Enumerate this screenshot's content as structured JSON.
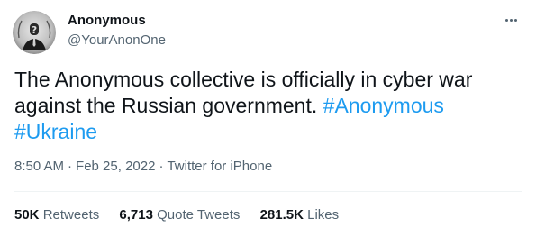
{
  "author": {
    "name": "Anonymous",
    "handle": "@YourAnonOne"
  },
  "tweet": {
    "text_line1": "The Anonymous collective is officially in cyber war",
    "text_line2_plain": "against the Russian government. ",
    "hashtags": [
      "#Anonymous",
      "#Ukraine"
    ]
  },
  "meta": {
    "time": "8:50 AM",
    "separator": "·",
    "date": "Feb 25, 2022",
    "source": "Twitter for iPhone"
  },
  "stats": {
    "retweets_count": "50K",
    "retweets_label": "Retweets",
    "quotes_count": "6,713",
    "quotes_label": "Quote Tweets",
    "likes_count": "281.5K",
    "likes_label": "Likes"
  },
  "icons": {
    "more": "more-horizontal-icon",
    "avatar": "anonymous-mask-avatar"
  },
  "colors": {
    "link": "#1d9bf0",
    "text": "#0f1419",
    "secondary": "#536471",
    "divider": "#eff3f4"
  }
}
